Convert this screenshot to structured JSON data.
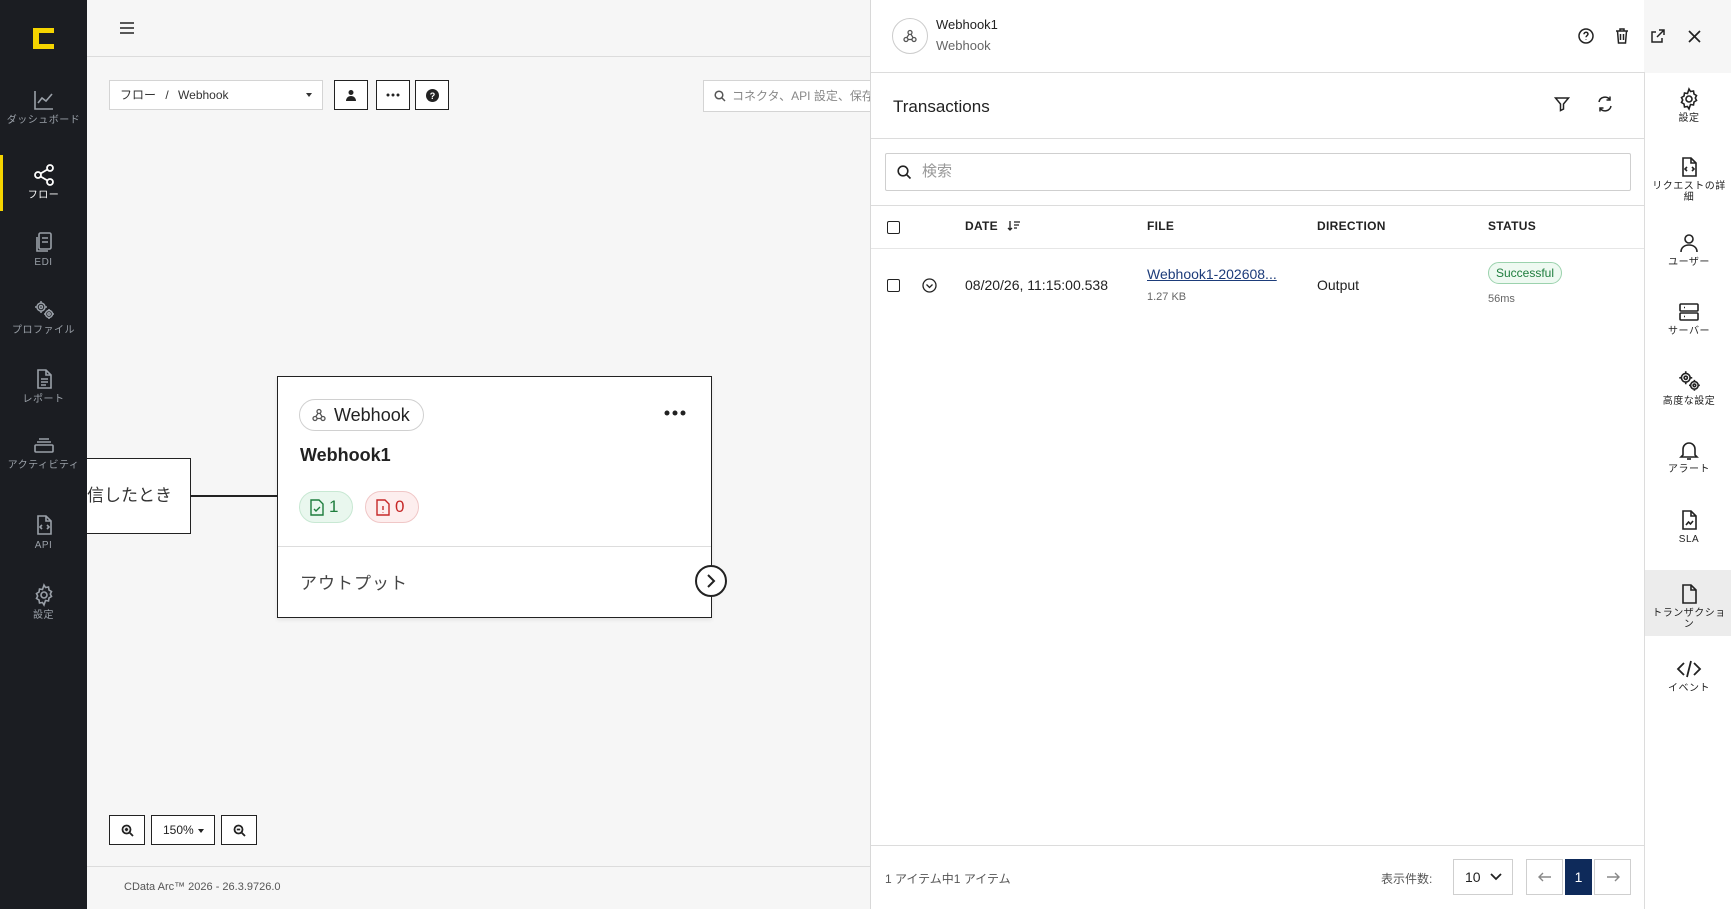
{
  "app": {
    "brand_color": "#f5d400",
    "version": "CData Arc™ 2026 - 26.3.9726.0"
  },
  "leftnav": {
    "items": [
      {
        "label": "ダッシュボード",
        "icon": "chart-icon"
      },
      {
        "label": "フロー",
        "icon": "flow-icon",
        "active": true
      },
      {
        "label": "EDI",
        "icon": "edi-icon"
      },
      {
        "label": "プロファイル",
        "icon": "profile-gears-icon"
      },
      {
        "label": "レポート",
        "icon": "report-icon"
      },
      {
        "label": "アクティビティ",
        "icon": "activity-icon"
      },
      {
        "label": "API",
        "icon": "api-icon"
      },
      {
        "label": "設定",
        "icon": "gear-icon"
      }
    ]
  },
  "canvas": {
    "breadcrumb": {
      "root": "フロー",
      "sep": "/",
      "current": "Webhook"
    },
    "search_placeholder": "コネクタ、API 設定、保存",
    "trigger_label": "信したとき",
    "node": {
      "type_label": "Webhook",
      "name": "Webhook1",
      "success_count": "1",
      "error_count": "0",
      "output_label": "アウトプット"
    },
    "zoom": "150%"
  },
  "panel": {
    "title": "Webhook1",
    "subtitle": "Webhook",
    "transactions": {
      "title": "Transactions",
      "search_placeholder": "検索",
      "columns": {
        "date": "DATE",
        "file": "FILE",
        "direction": "DIRECTION",
        "status": "STATUS"
      },
      "rows": [
        {
          "date": "08/20/26, 11:15:00.538",
          "file": "Webhook1-202608...",
          "size": "1.27 KB",
          "direction": "Output",
          "status": "Successful",
          "duration": "56ms"
        }
      ],
      "pagination": {
        "info": "1 アイテム中1 アイテム",
        "page_size_label": "表示件数:",
        "page_size": "10",
        "current_page": "1"
      }
    },
    "rail": [
      {
        "label": "設定",
        "icon": "gear-icon"
      },
      {
        "label": "リクエストの詳細",
        "icon": "request-detail-icon"
      },
      {
        "label": "ユーザー",
        "icon": "user-icon"
      },
      {
        "label": "サーバー",
        "icon": "server-icon"
      },
      {
        "label": "高度な設定",
        "icon": "advanced-gears-icon"
      },
      {
        "label": "アラート",
        "icon": "bell-icon"
      },
      {
        "label": "SLA",
        "icon": "sla-icon"
      },
      {
        "label": "トランザクション",
        "icon": "transaction-icon",
        "active": true
      },
      {
        "label": "イベント",
        "icon": "code-icon"
      }
    ]
  }
}
